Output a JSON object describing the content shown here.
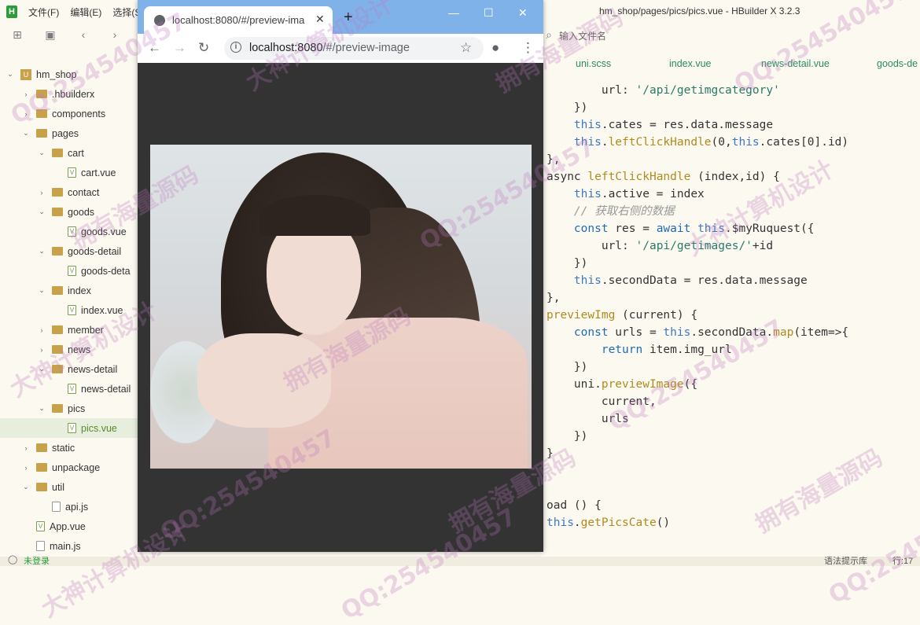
{
  "menu": {
    "items": [
      "文件(F)",
      "编辑(E)",
      "选择(S"
    ]
  },
  "window_title": "hm_shop/pages/pics/pics.vue - HBuilder X 3.2.3",
  "toolbar": {
    "file_search_placeholder": "输入文件名"
  },
  "sidebar": {
    "items": [
      {
        "label": "hm_shop",
        "type": "project",
        "depth": 0,
        "expanded": true
      },
      {
        "label": ".hbuilderx",
        "type": "folder",
        "depth": 1,
        "expanded": false
      },
      {
        "label": "components",
        "type": "folder",
        "depth": 1,
        "expanded": false
      },
      {
        "label": "pages",
        "type": "folder",
        "depth": 1,
        "expanded": true
      },
      {
        "label": "cart",
        "type": "folder",
        "depth": 2,
        "expanded": true
      },
      {
        "label": "cart.vue",
        "type": "vue",
        "depth": 3
      },
      {
        "label": "contact",
        "type": "folder",
        "depth": 2,
        "expanded": false
      },
      {
        "label": "goods",
        "type": "folder",
        "depth": 2,
        "expanded": true
      },
      {
        "label": "goods.vue",
        "type": "vue",
        "depth": 3
      },
      {
        "label": "goods-detail",
        "type": "folder",
        "depth": 2,
        "expanded": true
      },
      {
        "label": "goods-deta",
        "type": "vue",
        "depth": 3
      },
      {
        "label": "index",
        "type": "folder",
        "depth": 2,
        "expanded": true
      },
      {
        "label": "index.vue",
        "type": "vue",
        "depth": 3
      },
      {
        "label": "member",
        "type": "folder",
        "depth": 2,
        "expanded": false
      },
      {
        "label": "news",
        "type": "folder",
        "depth": 2,
        "expanded": false
      },
      {
        "label": "news-detail",
        "type": "folder",
        "depth": 2,
        "expanded": true
      },
      {
        "label": "news-detail",
        "type": "vue",
        "depth": 3
      },
      {
        "label": "pics",
        "type": "folder",
        "depth": 2,
        "expanded": true
      },
      {
        "label": "pics.vue",
        "type": "vue",
        "depth": 3,
        "selected": true
      },
      {
        "label": "static",
        "type": "folder",
        "depth": 1,
        "expanded": false
      },
      {
        "label": "unpackage",
        "type": "folder",
        "depth": 1,
        "expanded": false
      },
      {
        "label": "util",
        "type": "folder",
        "depth": 1,
        "expanded": true
      },
      {
        "label": "api.js",
        "type": "js",
        "depth": 2
      },
      {
        "label": "App.vue",
        "type": "vue",
        "depth": 1
      },
      {
        "label": "main.js",
        "type": "js",
        "depth": 1
      }
    ]
  },
  "editor_tabs": [
    "uni.scss",
    "index.vue",
    "news-detail.vue",
    "goods-de"
  ],
  "code_lines": [
    "        url: '/api/getimgcategory'",
    "    })",
    "    this.cates = res.data.message",
    "    this.leftClickHandle(0,this.cates[0].id)",
    "},",
    "async leftClickHandle (index,id) {",
    "    this.active = index",
    "    // 获取右侧的数据",
    "    const res = await this.$myRuquest({",
    "        url: '/api/getimages/'+id",
    "    })",
    "    this.secondData = res.data.message",
    "},",
    "previewImg (current) {",
    "    const urls = this.secondData.map(item=>{",
    "        return item.img_url",
    "    })",
    "    uni.previewImage({",
    "        current,",
    "        urls",
    "    })",
    "}",
    "",
    "",
    "oad () {",
    "this.getPicsCate()"
  ],
  "browser": {
    "tab_title": "localhost:8080/#/preview-ima",
    "url_host": "localhost:8080",
    "url_path": "/#/preview-image"
  },
  "statusbar": {
    "login": "未登录",
    "hint": "语法提示库",
    "position": "行:17"
  },
  "watermarks": [
    "大神计算机设计",
    "拥有海量源码",
    "QQ:254540457"
  ]
}
